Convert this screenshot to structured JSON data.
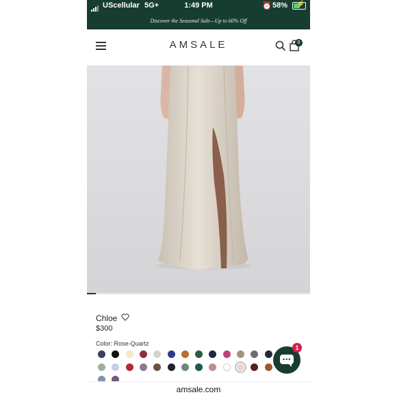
{
  "status_bar": {
    "carrier": "UScellular",
    "network": "5G+",
    "time": "1:49 PM",
    "battery": "58%",
    "battery_level": 0.58
  },
  "promo": {
    "text": "Discover the Seasonal Sale—Up to 60% Off"
  },
  "header": {
    "logo": "AMSALE",
    "cart_count": "0"
  },
  "product": {
    "name": "Chloe",
    "price": "$300",
    "color_label": "Color:",
    "color_value": "Rose-Quartz",
    "image_index": 0.04
  },
  "swatches": [
    {
      "name": "navy",
      "color": "#3a3f5c"
    },
    {
      "name": "black",
      "color": "#111111"
    },
    {
      "name": "cream",
      "color": "#f2e9c9"
    },
    {
      "name": "burgundy",
      "color": "#8f2e3a"
    },
    {
      "name": "champagne",
      "color": "#d9d3c6"
    },
    {
      "name": "cobalt",
      "color": "#2e3a8c"
    },
    {
      "name": "copper",
      "color": "#b5702f"
    },
    {
      "name": "forest",
      "color": "#2f5a3e"
    },
    {
      "name": "midnight",
      "color": "#1d2a4a"
    },
    {
      "name": "fuchsia",
      "color": "#c0407a"
    },
    {
      "name": "taupe",
      "color": "#a59278"
    },
    {
      "name": "charcoal",
      "color": "#6c6c6c"
    },
    {
      "name": "dark-navy",
      "color": "#222a38"
    },
    {
      "name": "sage",
      "color": "#9fb0a3"
    },
    {
      "name": "lavender",
      "color": "#c7cde9"
    },
    {
      "name": "red",
      "color": "#b8283a"
    },
    {
      "name": "mauve",
      "color": "#8d7a86"
    },
    {
      "name": "espresso",
      "color": "#6a5142"
    },
    {
      "name": "ink",
      "color": "#1c2230"
    },
    {
      "name": "eucalyptus",
      "color": "#6c8a76"
    },
    {
      "name": "emerald",
      "color": "#175c48"
    },
    {
      "name": "dusty-rose",
      "color": "#c18a96"
    },
    {
      "name": "white",
      "color": "#ffffff"
    },
    {
      "name": "rose-quartz",
      "color": "#f0d4cc"
    },
    {
      "name": "wine",
      "color": "#5a1b24"
    },
    {
      "name": "rust",
      "color": "#a5562f"
    },
    {
      "name": "slate-blue",
      "color": "#8090b5"
    },
    {
      "name": "plum",
      "color": "#6e5a7a"
    }
  ],
  "chat": {
    "badge": "1"
  },
  "url_bar": {
    "domain": "amsale.com"
  },
  "colors": {
    "brand_green": "#173d31",
    "badge_red": "#d21f4a"
  },
  "icons": [
    "menu-icon",
    "search-icon",
    "bag-icon",
    "heart-icon",
    "chat-icon"
  ]
}
